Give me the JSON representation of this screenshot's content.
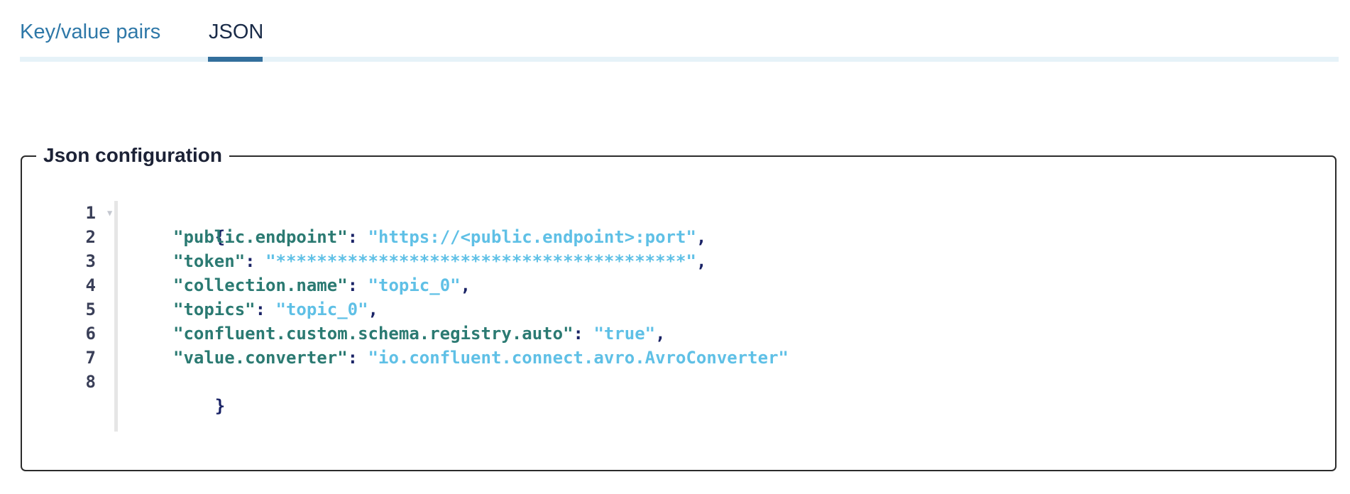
{
  "tabs": [
    {
      "label": "Key/value pairs",
      "active": false
    },
    {
      "label": "JSON",
      "active": true
    }
  ],
  "config": {
    "legend": "Json configuration",
    "open_brace": "{",
    "close_brace": "}",
    "line_numbers": [
      "1",
      "2",
      "3",
      "4",
      "5",
      "6",
      "7",
      "8"
    ],
    "entries": [
      {
        "key": "\"public.endpoint\"",
        "value": "\"https://<public.endpoint>:port\"",
        "comma": ","
      },
      {
        "key": "\"token\"",
        "value": "\"****************************************\"",
        "comma": ","
      },
      {
        "key": "\"collection.name\"",
        "value": "\"topic_0\"",
        "comma": ","
      },
      {
        "key": "\"topics\"",
        "value": "\"topic_0\"",
        "comma": ","
      },
      {
        "key": "\"confluent.custom.schema.registry.auto\"",
        "value": "\"true\"",
        "comma": ","
      },
      {
        "key": "\"value.converter\"",
        "value": "\"io.confluent.connect.avro.AvroConverter\"",
        "comma": ""
      }
    ],
    "colon": ": "
  },
  "colors": {
    "tab_active_underline": "#336f9c",
    "tab_inactive": "#2e78a8",
    "json_key": "#2b7a72",
    "json_string": "#5fc0e6",
    "json_punct": "#1a2366"
  },
  "icons": {
    "fold": "fold-triangle-icon"
  }
}
